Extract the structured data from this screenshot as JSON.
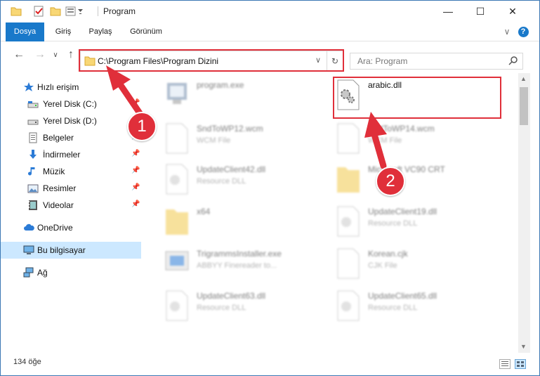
{
  "window": {
    "title": "Program",
    "minimize_glyph": "—",
    "maximize_glyph": "☐",
    "close_glyph": "✕"
  },
  "ribbon": {
    "tabs": [
      {
        "label": "Dosya"
      },
      {
        "label": "Giriş"
      },
      {
        "label": "Paylaş"
      },
      {
        "label": "Görünüm"
      }
    ],
    "expand_glyph": "∨",
    "help_glyph": "?"
  },
  "nav": {
    "back_glyph": "←",
    "forward_glyph": "→",
    "recent_glyph": "∨",
    "up_glyph": "↑",
    "address": "C:\\Program Files\\Program Dizini",
    "address_dropdown_glyph": "∨",
    "refresh_glyph": "↻",
    "search_placeholder": "Ara: Program"
  },
  "sidebar": {
    "items": [
      {
        "label": "Hızlı erişim",
        "icon": "star-icon"
      },
      {
        "label": "Yerel Disk (C:)",
        "icon": "drive-icon"
      },
      {
        "label": "Yerel Disk (D:)",
        "icon": "drive-icon"
      },
      {
        "label": "Belgeler",
        "icon": "documents-icon"
      },
      {
        "label": "İndirmeler",
        "icon": "download-icon"
      },
      {
        "label": "Müzik",
        "icon": "music-icon"
      },
      {
        "label": "Resimler",
        "icon": "pictures-icon"
      },
      {
        "label": "Videolar",
        "icon": "videos-icon"
      },
      {
        "label": "OneDrive",
        "icon": "cloud-icon"
      },
      {
        "label": "Bu bilgisayar",
        "icon": "computer-icon"
      },
      {
        "label": "Ağ",
        "icon": "network-icon"
      }
    ]
  },
  "files": [
    {
      "name": "program.exe",
      "type": ""
    },
    {
      "name": "arabic.dll",
      "type": ""
    },
    {
      "name": "SndToWP12.wcm",
      "type": "WCM File"
    },
    {
      "name": "SndToWP14.wcm",
      "type": "WCM File"
    },
    {
      "name": "UpdateClient42.dll",
      "type": "Resource DLL"
    },
    {
      "name": "Microsoft VC90 CRT",
      "type": ""
    },
    {
      "name": "x64",
      "type": ""
    },
    {
      "name": "UpdateClient19.dll",
      "type": "Resource DLL"
    },
    {
      "name": "TrigrammsInstaller.exe",
      "type": "ABBYY Finereader to..."
    },
    {
      "name": "Korean.cjk",
      "type": "CJK File"
    },
    {
      "name": "UpdateClient63.dll",
      "type": "Resource DLL"
    },
    {
      "name": "UpdateClient65.dll",
      "type": "Resource DLL"
    }
  ],
  "status": {
    "item_count": "134 öğe"
  },
  "annotations": {
    "step1": "1",
    "step2": "2",
    "highlight_color": "#e02f3a"
  },
  "colors": {
    "accent": "#1979ca",
    "selection": "#cce8ff"
  }
}
